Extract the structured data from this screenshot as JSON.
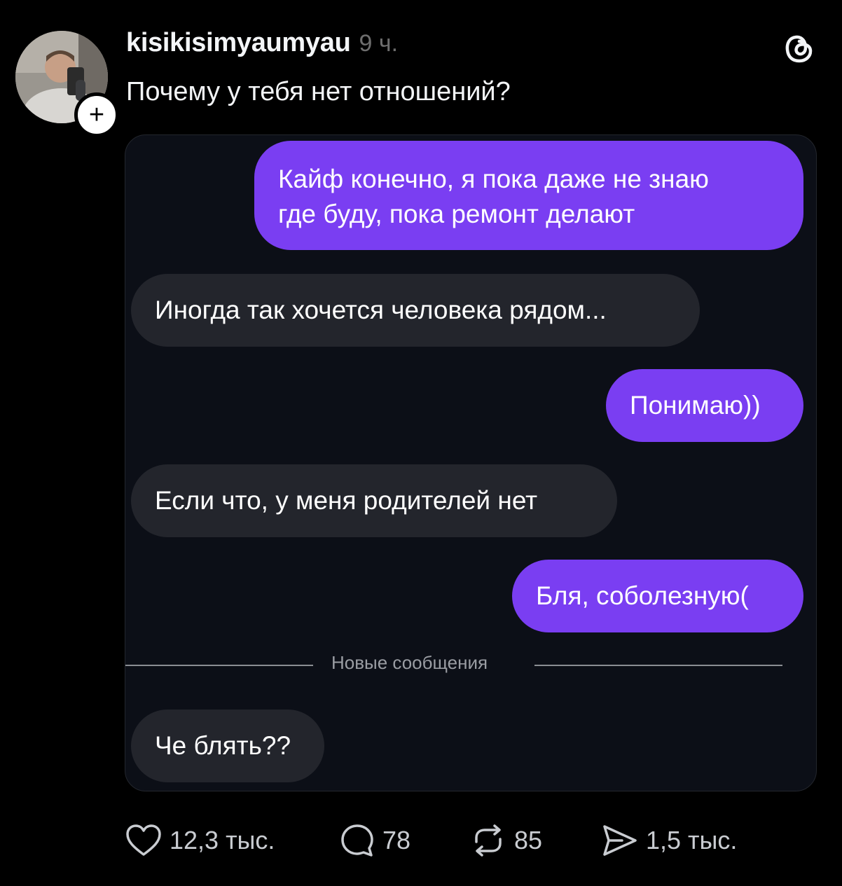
{
  "post": {
    "username": "kisikisimyaumyau",
    "timestamp": "9 ч.",
    "caption": "Почему у тебя нет отношений?",
    "app_icon": "threads-icon",
    "follow_icon": "plus-icon"
  },
  "chat": {
    "messages": [
      {
        "side": "outgoing",
        "text_line1": "Кайф конечно, я пока даже не знаю",
        "text_line2": "где буду, пока ремонт делают"
      },
      {
        "side": "incoming",
        "text": "Иногда так хочется человека рядом..."
      },
      {
        "side": "outgoing",
        "text": "Понимаю))"
      },
      {
        "side": "incoming",
        "text": "Если что, у меня родителей нет"
      },
      {
        "side": "outgoing",
        "text": "Бля, соболезную("
      },
      {
        "side": "incoming",
        "text": "Че блять??"
      }
    ],
    "divider_label": "Новые сообщения",
    "colors": {
      "outgoing_bubble": "#7a3ef2",
      "incoming_bubble": "#23252c",
      "card_background": "#0c0f17"
    }
  },
  "actions": {
    "likes": "12,3 тыс.",
    "replies": "78",
    "reposts": "85",
    "shares": "1,5 тыс."
  }
}
